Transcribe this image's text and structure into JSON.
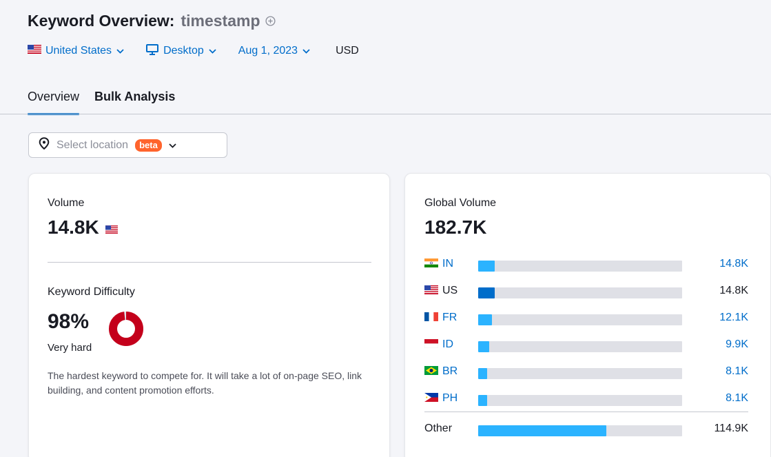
{
  "header": {
    "title": "Keyword Overview:",
    "keyword": "timestamp"
  },
  "filters": {
    "country": "United States",
    "device": "Desktop",
    "date": "Aug 1, 2023",
    "currency": "USD"
  },
  "tabs": [
    {
      "label": "Overview",
      "active": true
    },
    {
      "label": "Bulk Analysis",
      "active": false
    }
  ],
  "location_select": {
    "placeholder": "Select location",
    "badge": "beta"
  },
  "volume_card": {
    "volume_label": "Volume",
    "volume_value": "14.8K",
    "kd_label": "Keyword Difficulty",
    "kd_value": "98%",
    "kd_percent": 98,
    "kd_level": "Very hard",
    "kd_description": "The hardest keyword to compete for. It will take a lot of on-page SEO, link building, and content promotion efforts."
  },
  "global_card": {
    "label": "Global Volume",
    "value": "182.7K",
    "rows": [
      {
        "code": "IN",
        "flag": "india-flag",
        "value": "14.8K",
        "share": 0.081,
        "link": true,
        "color": "#2bb3ff"
      },
      {
        "code": "US",
        "flag": "us-flag",
        "value": "14.8K",
        "share": 0.081,
        "link": false,
        "color": "#006dca"
      },
      {
        "code": "FR",
        "flag": "france-flag",
        "value": "12.1K",
        "share": 0.066,
        "link": true,
        "color": "#2bb3ff"
      },
      {
        "code": "ID",
        "flag": "indonesia-flag",
        "value": "9.9K",
        "share": 0.054,
        "link": true,
        "color": "#2bb3ff"
      },
      {
        "code": "BR",
        "flag": "brazil-flag",
        "value": "8.1K",
        "share": 0.044,
        "link": true,
        "color": "#2bb3ff"
      },
      {
        "code": "PH",
        "flag": "philippines-flag",
        "value": "8.1K",
        "share": 0.044,
        "link": true,
        "color": "#2bb3ff"
      }
    ],
    "other": {
      "label": "Other",
      "value": "114.9K",
      "share": 0.629,
      "color": "#2bb3ff"
    }
  },
  "colors": {
    "accent": "#006dca",
    "bar_light": "#2bb3ff",
    "bar_track": "#dfe0e6",
    "kd_red": "#c4001b",
    "beta": "#ff642d"
  }
}
